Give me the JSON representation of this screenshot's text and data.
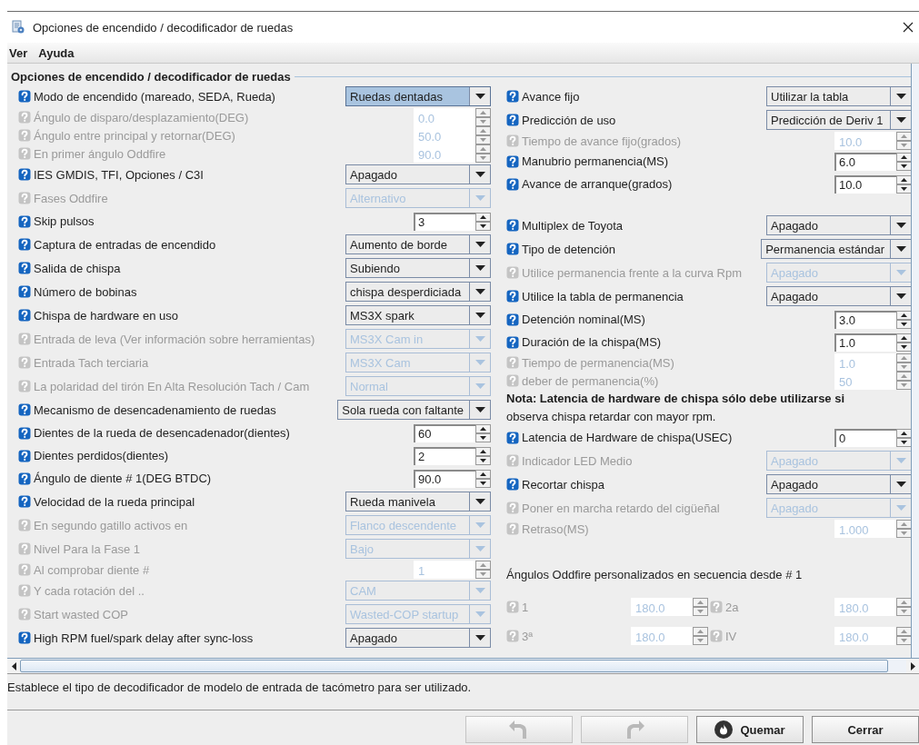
{
  "window": {
    "title": "Opciones de encendido / decodificador de ruedas"
  },
  "menu": [
    {
      "label": "Ver"
    },
    {
      "label": "Ayuda"
    }
  ],
  "panel": {
    "title": "Opciones de encendido / decodificador de ruedas",
    "left": [
      {
        "kind": "combo",
        "label": "Modo de encendido (mareado, SEDA, Rueda)",
        "value": "Ruedas dentadas",
        "enabled": true,
        "focused": true
      },
      {
        "kind": "spinner",
        "label": "Ángulo de disparo/desplazamiento(DEG)",
        "value": "0.0",
        "enabled": false
      },
      {
        "kind": "spinner",
        "label": "Ángulo entre principal y retornar(DEG)",
        "value": "50.0",
        "enabled": false
      },
      {
        "kind": "spinner",
        "label": "En primer ángulo Oddfire",
        "value": "90.0",
        "enabled": false
      },
      {
        "kind": "combo",
        "label": "IES GMDIS, TFI, Opciones / C3I",
        "value": "Apagado",
        "enabled": true,
        "focused": false
      },
      {
        "kind": "combo",
        "label": "Fases Oddfire",
        "value": "Alternativo",
        "enabled": false,
        "focused": false
      },
      {
        "kind": "spinner",
        "label": "Skip pulsos",
        "value": "3",
        "enabled": true
      },
      {
        "kind": "combo",
        "label": "Captura de entradas de encendido",
        "value": "Aumento de borde",
        "enabled": true,
        "focused": false
      },
      {
        "kind": "combo",
        "label": "Salida de chispa",
        "value": "Subiendo",
        "enabled": true,
        "focused": false
      },
      {
        "kind": "combo",
        "label": "Número de bobinas",
        "value": "chispa desperdiciada",
        "enabled": true,
        "focused": false
      },
      {
        "kind": "combo",
        "label": "Chispa de hardware en uso",
        "value": "MS3X spark",
        "enabled": true,
        "focused": false
      },
      {
        "kind": "combo",
        "label": "Entrada de leva (Ver información sobre herramientas)",
        "value": "MS3X Cam in",
        "enabled": false,
        "focused": false
      },
      {
        "kind": "combo",
        "label": "Entrada Tach terciaria",
        "value": "MS3X Cam",
        "enabled": false,
        "focused": false
      },
      {
        "kind": "combo",
        "label": "La polaridad del tirón En Alta Resolución Tach / Cam",
        "value": "Normal",
        "enabled": false,
        "focused": false
      },
      {
        "kind": "combo",
        "label": "Mecanismo de desencadenamiento de ruedas",
        "value": "Sola rueda con faltante",
        "enabled": true,
        "focused": false
      },
      {
        "kind": "spinner",
        "label": "Dientes de la rueda de desencadenador(dientes)",
        "value": "60",
        "enabled": true
      },
      {
        "kind": "spinner",
        "label": "Dientes perdidos(dientes)",
        "value": "2",
        "enabled": true
      },
      {
        "kind": "spinner",
        "label": "Ángulo de diente # 1(DEG BTDC)",
        "value": "90.0",
        "enabled": true
      },
      {
        "kind": "combo",
        "label": "Velocidad de la rueda principal",
        "value": "Rueda manivela",
        "enabled": true,
        "focused": false
      },
      {
        "kind": "combo",
        "label": "En segundo gatillo activos en",
        "value": "Flanco descendente",
        "enabled": false,
        "focused": false
      },
      {
        "kind": "combo",
        "label": "Nivel Para la Fase 1",
        "value": "Bajo",
        "enabled": false,
        "focused": false
      },
      {
        "kind": "spinner",
        "label": "Al comprobar diente #",
        "value": "1",
        "enabled": false
      },
      {
        "kind": "combo",
        "label": "Y cada rotación del ..",
        "value": "CAM",
        "enabled": false,
        "focused": false
      },
      {
        "kind": "combo",
        "label": "Start wasted COP",
        "value": "Wasted-COP startup",
        "enabled": false,
        "focused": false
      },
      {
        "kind": "combo",
        "label": "High RPM fuel/spark delay after sync-loss",
        "value": "Apagado",
        "enabled": true,
        "focused": false
      }
    ],
    "right": {
      "sections": [
        {
          "rows": [
            {
              "kind": "combo",
              "label": "Avance fijo",
              "value": "Utilizar la tabla",
              "enabled": true,
              "focused": false
            },
            {
              "kind": "combo",
              "label": "Predicción de uso",
              "value": "Predicción de Deriv 1",
              "enabled": true,
              "focused": false
            },
            {
              "kind": "spinner",
              "label": "Tiempo de avance fijo(grados)",
              "value": "10.0",
              "enabled": false
            },
            {
              "kind": "spinner",
              "label": "Manubrio permanencia(MS)",
              "value": "6.0",
              "enabled": true
            },
            {
              "kind": "spinner",
              "label": "Avance de arranque(grados)",
              "value": "10.0",
              "enabled": true
            }
          ]
        },
        {
          "rows": [
            {
              "kind": "combo",
              "label": "Multiplex de Toyota",
              "value": "Apagado",
              "enabled": true,
              "focused": false
            },
            {
              "kind": "combo",
              "label": "Tipo de detención",
              "value": "Permanencia estándar",
              "enabled": true,
              "focused": false
            },
            {
              "kind": "combo",
              "label": "Utilice permanencia frente a la curva Rpm",
              "value": "Apagado",
              "enabled": false,
              "focused": false
            },
            {
              "kind": "combo",
              "label": "Utilice la tabla de permanencia",
              "value": "Apagado",
              "enabled": true,
              "focused": false
            },
            {
              "kind": "spinner",
              "label": "Detención nominal(MS)",
              "value": "3.0",
              "enabled": true
            },
            {
              "kind": "spinner",
              "label": "Duración de la chispa(MS)",
              "value": "1.0",
              "enabled": true
            },
            {
              "kind": "spinner",
              "label": "Tiempo de permanencia(MS)",
              "value": "1.0",
              "enabled": false
            },
            {
              "kind": "spinner",
              "label": "deber de permanencia(%)",
              "value": "50",
              "enabled": false
            },
            {
              "kind": "note",
              "title": "Nota: Latencia de hardware de chispa sólo debe utilizarse si",
              "text": "observa chispa retardar con mayor rpm."
            },
            {
              "kind": "spinner",
              "label": "Latencia de Hardware de chispa(USEC)",
              "value": "0",
              "enabled": true
            },
            {
              "kind": "combo",
              "label": "Indicador LED Medio",
              "value": "Apagado",
              "enabled": false,
              "focused": false
            },
            {
              "kind": "combo",
              "label": "Recortar chispa",
              "value": "Apagado",
              "enabled": true,
              "focused": false
            },
            {
              "kind": "combo",
              "label": "Poner en marcha retardo del cigüeñal",
              "value": "Apagado",
              "enabled": false,
              "focused": false
            },
            {
              "kind": "spinner",
              "label": "Retraso(MS)",
              "value": "1.000",
              "enabled": false
            }
          ]
        },
        {
          "rows": [
            {
              "kind": "heading",
              "text": "Ángulos Oddfire personalizados en secuencia desde # 1"
            },
            {
              "kind": "pair",
              "items": [
                {
                  "label": "1",
                  "value": "180.0",
                  "enabled": false
                },
                {
                  "label": "2a",
                  "value": "180.0",
                  "enabled": false
                }
              ]
            },
            {
              "kind": "pair",
              "items": [
                {
                  "label": "3ª",
                  "value": "180.0",
                  "enabled": false
                },
                {
                  "label": "IV",
                  "value": "180.0",
                  "enabled": false
                }
              ]
            }
          ]
        }
      ]
    }
  },
  "status_bar": "Establece el tipo de decodificador de modelo de entrada de tacómetro para ser utilizado.",
  "buttons": [
    {
      "kind": "undo",
      "disabled": true
    },
    {
      "kind": "redo",
      "disabled": true
    },
    {
      "kind": "burn",
      "label": "Quemar",
      "disabled": false
    },
    {
      "kind": "close",
      "label": "Cerrar",
      "disabled": false
    }
  ]
}
